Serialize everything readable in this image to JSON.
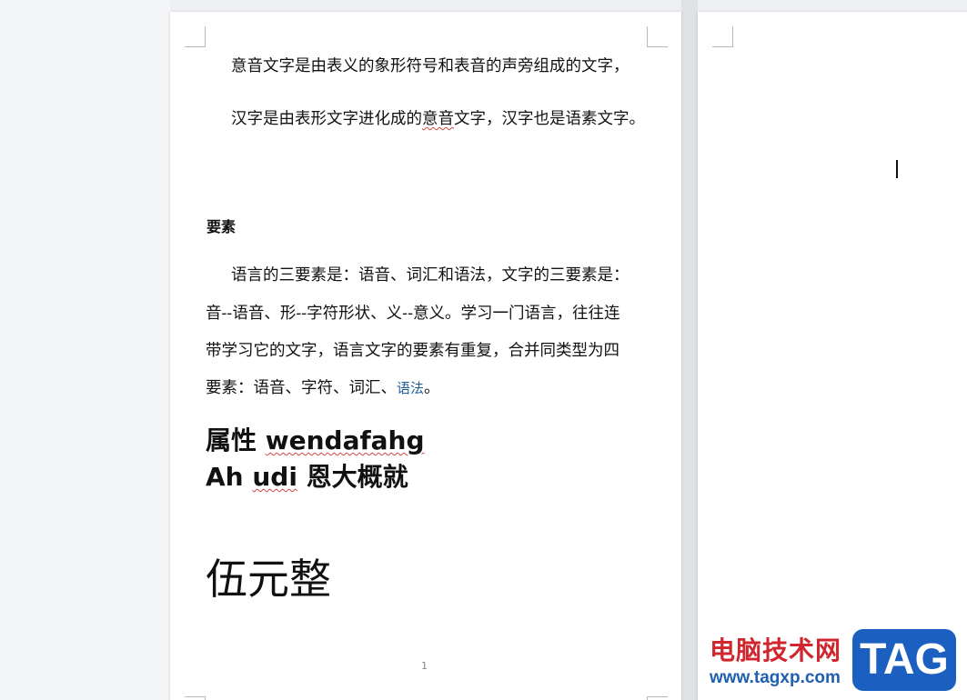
{
  "page1": {
    "para1_line1": "意音文字是由表义的象形符号和表音的声旁组成的文字，",
    "para1_line2_before": "汉字是由表形文字进化成的",
    "para1_line2_marked": "意音",
    "para1_line2_after": "文字，汉字也是语素文字。",
    "heading": "要素",
    "para2_line1": "语言的三要素是：语音、词汇和语法，文字的三要素是：",
    "para2_line2": "音--语音、形--字符形状、义--意义。学习一门语言，往往连",
    "para2_line3": "带学习它的文字，语言文字的要素有重复，合并同类型为四",
    "para2_line4_before": "要素：语音、字符、词汇、",
    "para2_line4_link": "语法",
    "para2_line4_after": "。",
    "big1_cn": "属性 ",
    "big1_en": "wendafahg",
    "big2_en1": "Ah ",
    "big2_en2": "udi",
    "big2_cn": " 恩大概就",
    "huge": "伍元整",
    "page_number": "1"
  },
  "watermark": {
    "cn": "电脑技术网",
    "url": "www.tagxp.com",
    "badge": "TAG",
    "colors": {
      "red": "#d0272f",
      "blue": "#1b5fc1"
    }
  }
}
